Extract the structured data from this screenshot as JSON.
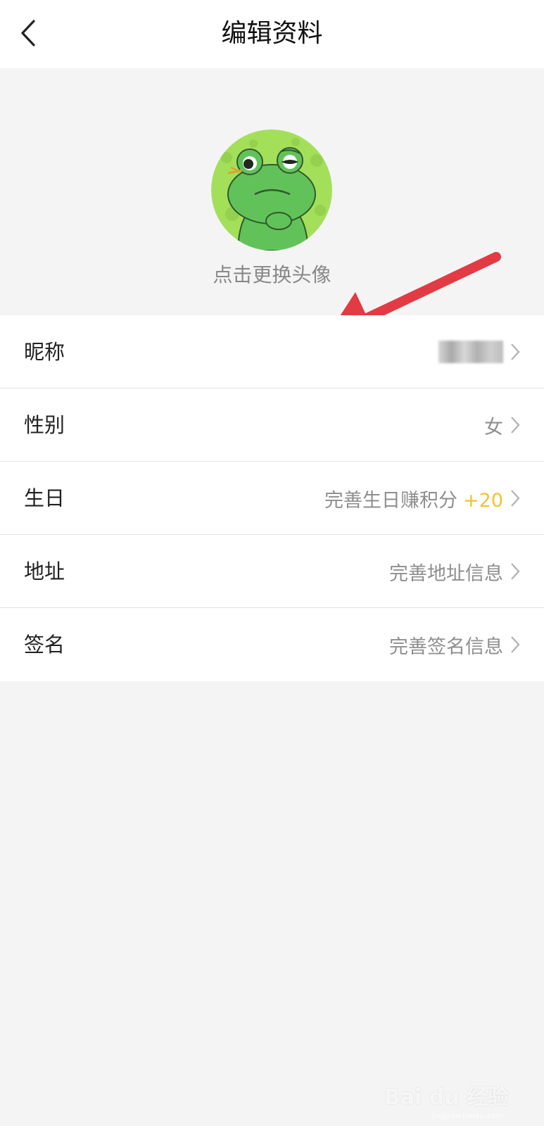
{
  "header": {
    "title": "编辑资料",
    "back_icon": "chevron-left-icon"
  },
  "avatar": {
    "hint": "点击更换头像",
    "image": "frog-cartoon-avatar",
    "annotation_color": "#e23b44"
  },
  "profile_rows": [
    {
      "label": "昵称",
      "value": "",
      "blurred": true
    },
    {
      "label": "性别",
      "value": "女"
    },
    {
      "label": "生日",
      "value": "完善生日赚积分",
      "bonus": "+20"
    },
    {
      "label": "地址",
      "value": "完善地址信息"
    },
    {
      "label": "签名",
      "value": "完善签名信息"
    }
  ],
  "colors": {
    "bonus": "#f2c230",
    "value_text": "#8e8e8e",
    "background": "#f4f4f4"
  },
  "watermark": {
    "text": "Bai du 经验",
    "sub": "jingyan.baidu.com"
  }
}
